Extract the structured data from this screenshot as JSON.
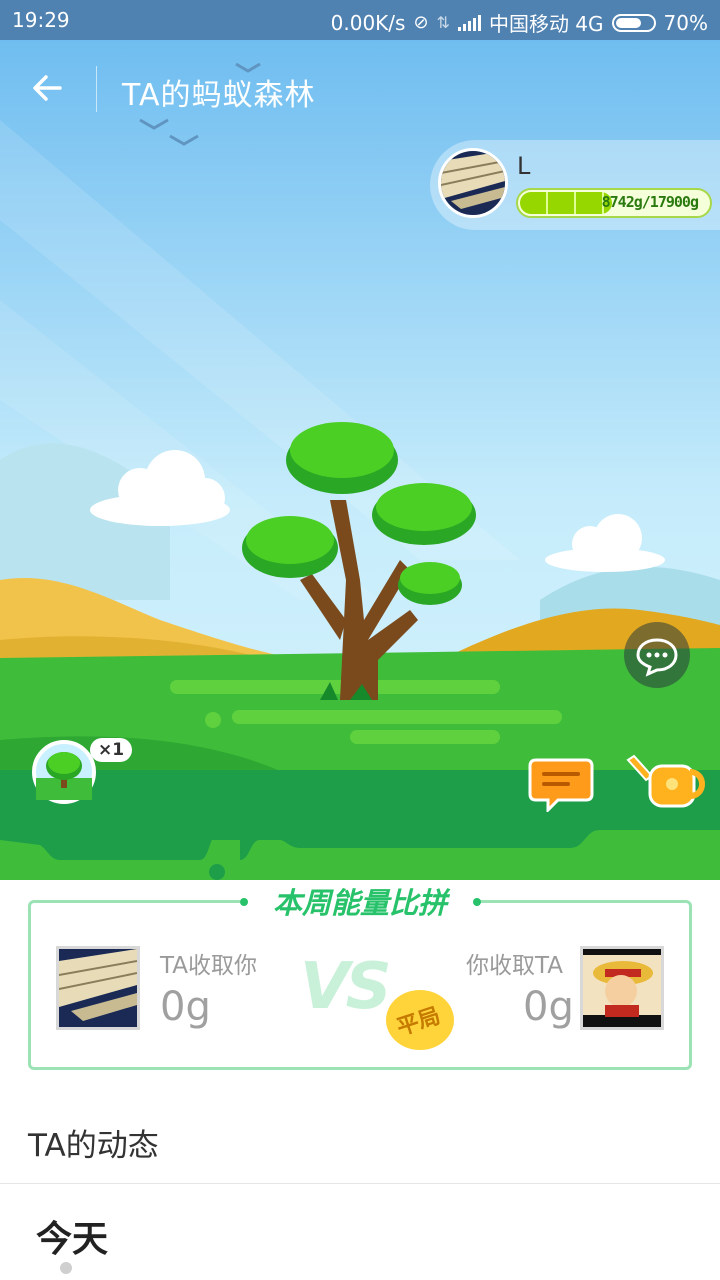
{
  "status_bar": {
    "time": "19:29",
    "network_speed": "0.00K/s",
    "carrier": "中国移动 4G",
    "battery": "70%",
    "battery_level": 0.7
  },
  "header": {
    "title": "TA的蚂蚁森林",
    "back_icon": "arrow-left-icon"
  },
  "owner": {
    "name": "L",
    "energy_text": "8742g/17900g",
    "energy_fraction": 0.488
  },
  "scene": {
    "tree_count": "×1",
    "icons": [
      "chat-bubble-icon",
      "message-icon",
      "watering-can-icon",
      "tree-icon"
    ]
  },
  "compare": {
    "title": "本周能量比拼",
    "left_label": "TA收取你",
    "left_value": "0g",
    "right_label": "你收取TA",
    "right_value": "0g",
    "vs_text": "VS",
    "result_badge": "平局"
  },
  "feed": {
    "title": "TA的动态",
    "section_today": "今天"
  },
  "colors": {
    "status_bar": "#4f81b1",
    "accent_green": "#27c26a",
    "badge_yellow": "#ffd43b",
    "orange": "#ff9b1a"
  }
}
